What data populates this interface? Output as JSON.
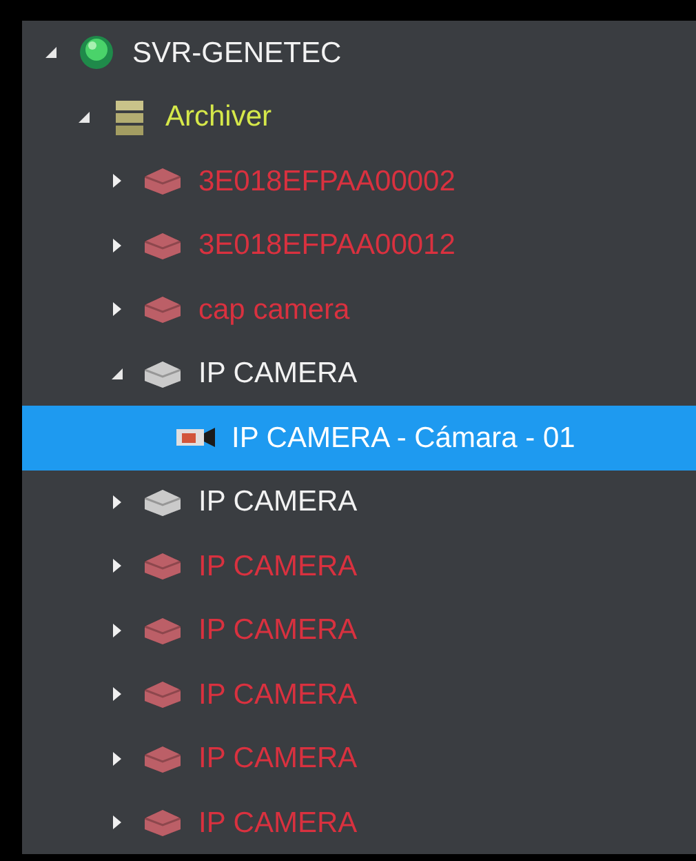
{
  "tree": [
    {
      "label": "SVR-GENETEC",
      "kind": "server",
      "color": "#f2f2f2",
      "expanded": true,
      "selected": false,
      "children": [
        {
          "label": "Archiver",
          "kind": "archiver",
          "color": "#d6e84a",
          "expanded": true,
          "selected": false,
          "children": [
            {
              "label": "3E018EFPAA00002",
              "kind": "unit",
              "color": "#d9313f",
              "expanded": false,
              "selected": false
            },
            {
              "label": "3E018EFPAA00012",
              "kind": "unit",
              "color": "#d9313f",
              "expanded": false,
              "selected": false
            },
            {
              "label": "cap camera",
              "kind": "unit",
              "color": "#d9313f",
              "expanded": false,
              "selected": false
            },
            {
              "label": "IP CAMERA",
              "kind": "unit",
              "color": "#f2f2f2",
              "expanded": true,
              "selected": false,
              "children": [
                {
                  "label": "IP CAMERA - Cámara - 01",
                  "kind": "camera",
                  "color": "#ffffff",
                  "selected": true
                }
              ]
            },
            {
              "label": "IP CAMERA",
              "kind": "unit",
              "color": "#f2f2f2",
              "expanded": false,
              "selected": false
            },
            {
              "label": "IP CAMERA",
              "kind": "unit",
              "color": "#d9313f",
              "expanded": false,
              "selected": false
            },
            {
              "label": "IP CAMERA",
              "kind": "unit",
              "color": "#d9313f",
              "expanded": false,
              "selected": false
            },
            {
              "label": "IP CAMERA",
              "kind": "unit",
              "color": "#d9313f",
              "expanded": false,
              "selected": false
            },
            {
              "label": "IP CAMERA",
              "kind": "unit",
              "color": "#d9313f",
              "expanded": false,
              "selected": false
            },
            {
              "label": "IP CAMERA",
              "kind": "unit",
              "color": "#d9313f",
              "expanded": false,
              "selected": false
            }
          ]
        }
      ]
    }
  ]
}
